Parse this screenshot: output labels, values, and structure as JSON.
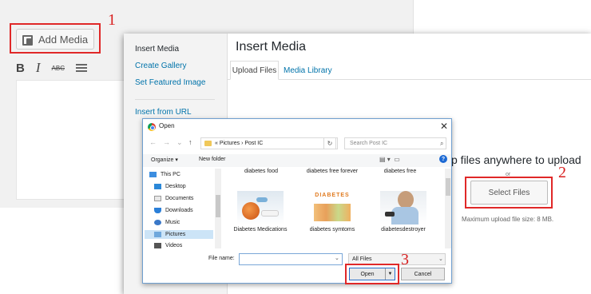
{
  "editor": {
    "add_media_label": "Add Media",
    "toolbar": {
      "bold": "B",
      "italic": "I",
      "strike": "ABC"
    }
  },
  "annotations": {
    "step1": "1",
    "step2": "2",
    "step3": "3"
  },
  "modal": {
    "menu": {
      "insert_media": "Insert Media",
      "create_gallery": "Create Gallery",
      "set_featured": "Set Featured Image",
      "insert_url": "Insert from URL"
    },
    "title": "Insert Media",
    "tabs": {
      "upload": "Upload Files",
      "library": "Media Library"
    },
    "drop_text": "p files anywhere to upload",
    "or": "or",
    "select_files": "Select Files",
    "max_size": "Maximum upload file size: 8 MB."
  },
  "dialog": {
    "title": "Open",
    "close": "✕",
    "path": "« Pictures › Post IC",
    "search_placeholder": "Search Post IC",
    "organize": "Organize ▾",
    "new_folder": "New folder",
    "nav_items": [
      "This PC",
      "Desktop",
      "Documents",
      "Downloads",
      "Music",
      "Pictures",
      "Videos"
    ],
    "top_files": [
      "diabetes food",
      "diabetes free forever",
      "diabetes free"
    ],
    "files": [
      "Diabetes Medications",
      "diabetes symtoms",
      "diabetesdestroyer"
    ],
    "thumb_letters": [
      "D",
      "I",
      "A",
      "B",
      "E",
      "T",
      "E",
      "S"
    ],
    "file_name_label": "File name:",
    "filter": "All Files",
    "open": "Open",
    "cancel": "Cancel"
  },
  "colors": {
    "annotation_red": "#e02828",
    "link_blue": "#0073aa",
    "dialog_border": "#6f9fd0"
  }
}
